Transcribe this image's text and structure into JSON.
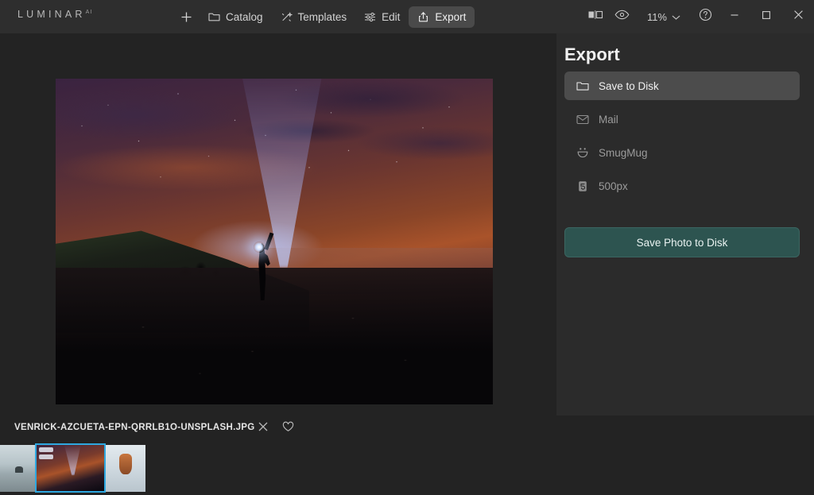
{
  "app": {
    "brand_name": "LUMINAR",
    "brand_superscript": "AI"
  },
  "toolbar": {
    "add_label": "",
    "catalog_label": "Catalog",
    "templates_label": "Templates",
    "edit_label": "Edit",
    "export_label": "Export",
    "zoom_level": "11%",
    "icons": {
      "add": "plus-icon",
      "catalog": "folder-icon",
      "templates": "sparkle-icon",
      "edit": "sliders-icon",
      "export": "share-upload-icon",
      "compare": "before-after-compare-icon",
      "preview": "eye-icon",
      "zoom_chevron": "chevron-down-icon",
      "help": "help-circle-icon",
      "minimize": "minimize-icon",
      "maximize": "maximize-icon",
      "close": "close-icon"
    }
  },
  "export_panel": {
    "title": "Export",
    "destinations": [
      {
        "label": "Save to Disk",
        "icon": "folder-icon",
        "selected": true
      },
      {
        "label": "Mail",
        "icon": "envelope-icon",
        "selected": false
      },
      {
        "label": "SmugMug",
        "icon": "smugmug-smiley-icon",
        "selected": false
      },
      {
        "label": "500px",
        "icon": "500px-logo-icon",
        "selected": false
      }
    ],
    "primary_button": "Save Photo to Disk",
    "accent_color": "#2d5450"
  },
  "filebar": {
    "filename": "VENRICK-AZCUETA-EPN-QRRLB1O-UNSPLASH.JPG",
    "close_icon": "close-icon",
    "favorite_icon": "heart-icon"
  },
  "filmstrip": {
    "selection_color": "#2ea8e0",
    "thumbnails": [
      {
        "name": "thumbnail-1",
        "selected": false
      },
      {
        "name": "thumbnail-2",
        "selected": true
      },
      {
        "name": "thumbnail-3",
        "selected": false
      }
    ]
  },
  "canvas": {
    "photo_alt": "night-sky-flashlight-beach-photo"
  }
}
